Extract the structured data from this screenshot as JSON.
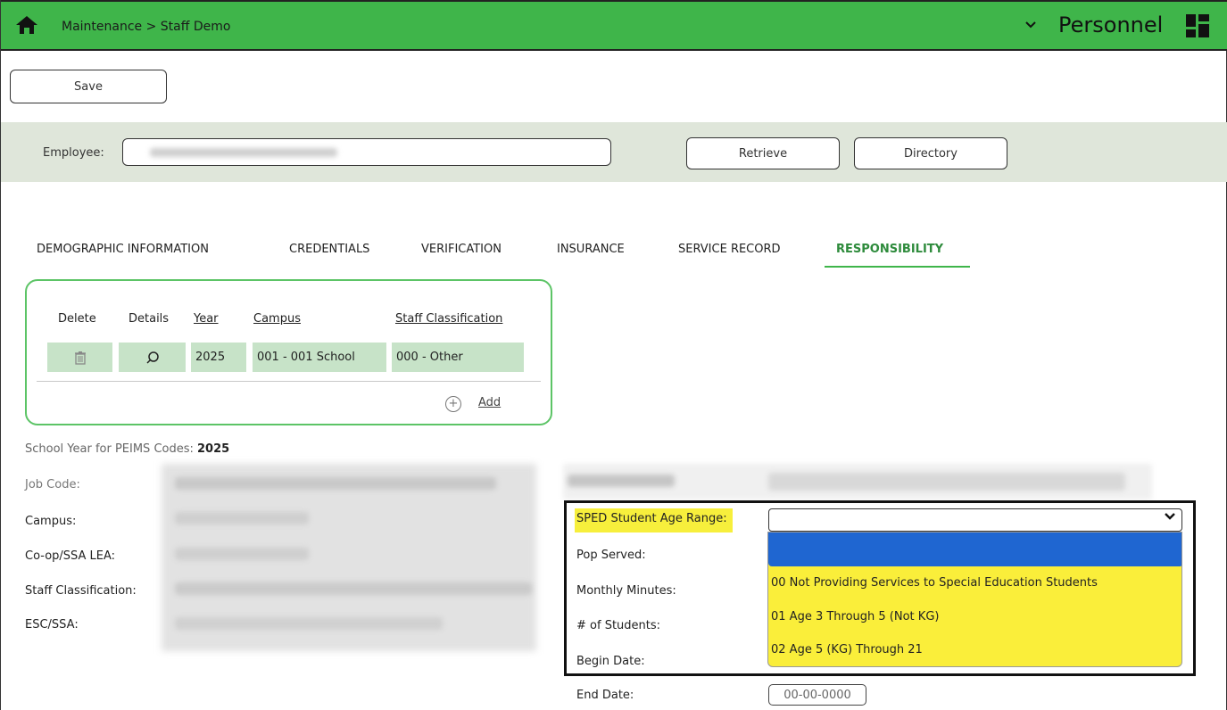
{
  "header": {
    "breadcrumb": "Maintenance > Staff Demo",
    "app_title": "Personnel",
    "chevron": "⌄",
    "icons": [
      "home-icon",
      "chevron-down-icon",
      "app-grid-icon"
    ]
  },
  "toolbar": {
    "save_label": "Save"
  },
  "employee": {
    "label": "Employee:",
    "retrieve_label": "Retrieve",
    "directory_label": "Directory"
  },
  "tabs": [
    {
      "label": "DEMOGRAPHIC INFORMATION",
      "active": false
    },
    {
      "label": "CREDENTIALS",
      "active": false
    },
    {
      "label": "VERIFICATION",
      "active": false
    },
    {
      "label": "INSURANCE",
      "active": false
    },
    {
      "label": "SERVICE RECORD",
      "active": false
    },
    {
      "label": "RESPONSIBILITY",
      "active": true
    }
  ],
  "responsibility_table": {
    "headers": [
      "Delete",
      "Details",
      "Year",
      "Campus",
      "Staff Classification"
    ],
    "rows": [
      {
        "year": "2025",
        "campus": "001 - 001 School",
        "staff_classification": "000 - Other"
      }
    ],
    "add_label": "Add"
  },
  "peims": {
    "label": "School Year for PEIMS Codes:",
    "value": "2025"
  },
  "left_fields": [
    "Job Code:",
    "Campus:",
    "Co-op/SSA LEA:",
    "Staff Classification:",
    "ESC/SSA:"
  ],
  "right_fields": {
    "sped_label": "SPED Student Age Range:",
    "pop_served": "Pop Served:",
    "monthly_minutes": "Monthly Minutes:",
    "num_students": "# of Students:",
    "begin_date": "Begin Date:",
    "end_date": "End Date:",
    "end_date_placeholder": "00-00-0000"
  },
  "sped_dropdown": {
    "selected": "",
    "options": [
      "00 Not Providing Services to Special Education Students",
      "01 Age 3 Through 5 (Not KG)",
      "02 Age 5 (KG) Through 21"
    ]
  },
  "colors": {
    "header_green": "#3fb54a",
    "active_tab": "#2e8b3c",
    "highlight_yellow": "#f7ef3c",
    "selection_blue": "#1f66d1"
  }
}
